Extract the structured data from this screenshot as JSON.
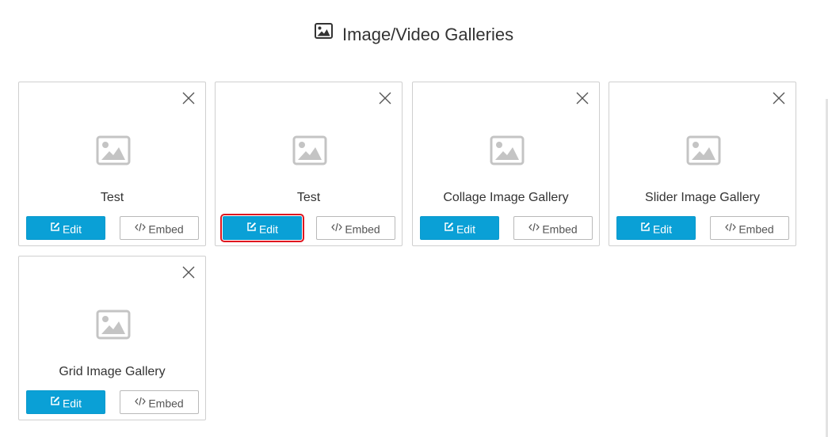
{
  "header": {
    "title": "Image/Video Galleries",
    "icon": "image-icon"
  },
  "colors": {
    "edit_button": "#0aa0d6",
    "edit_highlight_outline": "#e0161f",
    "card_border": "#cfcfcf",
    "placeholder_icon": "#c4c4c4"
  },
  "galleries": [
    {
      "title": "Test",
      "edit_label": "Edit",
      "embed_label": "Embed",
      "edit_icon": "edit-icon",
      "embed_icon": "code-icon",
      "close_icon": "close-icon",
      "thumbnail_icon": "image-placeholder-icon"
    },
    {
      "title": "Test",
      "edit_label": "Edit",
      "embed_label": "Embed",
      "edit_icon": "edit-icon",
      "embed_icon": "code-icon",
      "close_icon": "close-icon",
      "thumbnail_icon": "image-placeholder-icon"
    },
    {
      "title": "Collage Image Gallery",
      "edit_label": "Edit",
      "embed_label": "Embed",
      "edit_icon": "edit-icon",
      "embed_icon": "code-icon",
      "close_icon": "close-icon",
      "thumbnail_icon": "image-placeholder-icon"
    },
    {
      "title": "Slider Image Gallery",
      "edit_label": "Edit",
      "embed_label": "Embed",
      "edit_icon": "edit-icon",
      "embed_icon": "code-icon",
      "close_icon": "close-icon",
      "thumbnail_icon": "image-placeholder-icon"
    },
    {
      "title": "Grid Image Gallery",
      "edit_label": "Edit",
      "embed_label": "Embed",
      "edit_icon": "edit-icon",
      "embed_icon": "code-icon",
      "close_icon": "close-icon",
      "thumbnail_icon": "image-placeholder-icon"
    }
  ]
}
